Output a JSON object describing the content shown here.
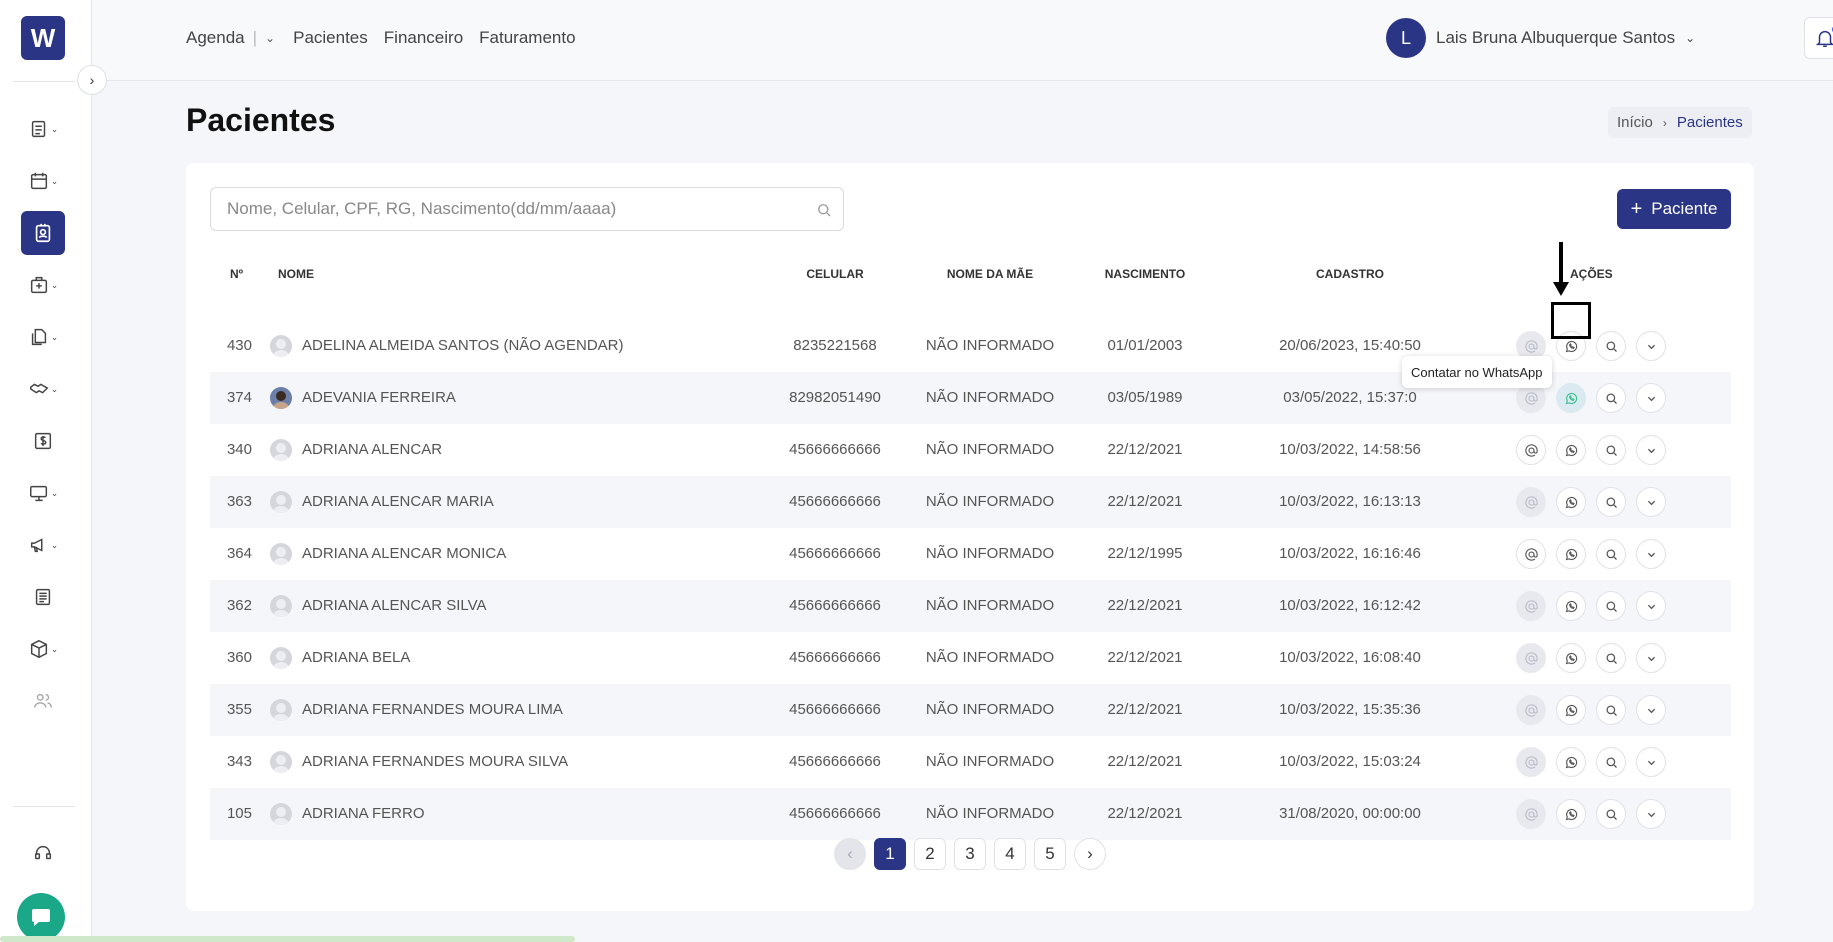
{
  "app": {
    "logo_letter": "W"
  },
  "nav": {
    "items": [
      "Agenda",
      "Pacientes",
      "Financeiro",
      "Faturamento"
    ]
  },
  "user": {
    "initial": "L",
    "name": "Lais Bruna Albuquerque Santos"
  },
  "page": {
    "title": "Pacientes"
  },
  "breadcrumb": {
    "home": "Início",
    "current": "Pacientes"
  },
  "search": {
    "placeholder": "Nome, Celular, CPF, RG, Nascimento(dd/mm/aaaa)",
    "value": ""
  },
  "add_button": {
    "label": "Paciente"
  },
  "table": {
    "headers": {
      "num": "Nº",
      "name": "NOME",
      "phone": "CELULAR",
      "mae": "NOME DA MÃE",
      "birth": "NASCIMENTO",
      "cad": "CADASTRO",
      "actions": "AÇÕES"
    },
    "rows": [
      {
        "num": "430",
        "name": "ADELINA ALMEIDA SANTOS (NÃO AGENDAR)",
        "phone": "8235221568",
        "mae": "NÃO INFORMADO",
        "birth": "01/01/2003",
        "cad": "20/06/2023, 15:40:50",
        "email_enabled": false,
        "photo": false
      },
      {
        "num": "374",
        "name": "ADEVANIA FERREIRA",
        "phone": "82982051490",
        "mae": "NÃO INFORMADO",
        "birth": "03/05/1989",
        "cad": "03/05/2022, 15:37:0",
        "email_enabled": false,
        "photo": true
      },
      {
        "num": "340",
        "name": "ADRIANA ALENCAR",
        "phone": "45666666666",
        "mae": "NÃO INFORMADO",
        "birth": "22/12/2021",
        "cad": "10/03/2022, 14:58:56",
        "email_enabled": true,
        "photo": false
      },
      {
        "num": "363",
        "name": "ADRIANA ALENCAR MARIA",
        "phone": "45666666666",
        "mae": "NÃO INFORMADO",
        "birth": "22/12/2021",
        "cad": "10/03/2022, 16:13:13",
        "email_enabled": false,
        "photo": false
      },
      {
        "num": "364",
        "name": "ADRIANA ALENCAR MONICA",
        "phone": "45666666666",
        "mae": "NÃO INFORMADO",
        "birth": "22/12/1995",
        "cad": "10/03/2022, 16:16:46",
        "email_enabled": true,
        "photo": false
      },
      {
        "num": "362",
        "name": "ADRIANA ALENCAR SILVA",
        "phone": "45666666666",
        "mae": "NÃO INFORMADO",
        "birth": "22/12/2021",
        "cad": "10/03/2022, 16:12:42",
        "email_enabled": false,
        "photo": false
      },
      {
        "num": "360",
        "name": "ADRIANA BELA",
        "phone": "45666666666",
        "mae": "NÃO INFORMADO",
        "birth": "22/12/2021",
        "cad": "10/03/2022, 16:08:40",
        "email_enabled": false,
        "photo": false
      },
      {
        "num": "355",
        "name": "ADRIANA FERNANDES MOURA LIMA",
        "phone": "45666666666",
        "mae": "NÃO INFORMADO",
        "birth": "22/12/2021",
        "cad": "10/03/2022, 15:35:36",
        "email_enabled": false,
        "photo": false
      },
      {
        "num": "343",
        "name": "ADRIANA FERNANDES MOURA SILVA",
        "phone": "45666666666",
        "mae": "NÃO INFORMADO",
        "birth": "22/12/2021",
        "cad": "10/03/2022, 15:03:24",
        "email_enabled": false,
        "photo": false
      },
      {
        "num": "105",
        "name": "ADRIANA FERRO",
        "phone": "45666666666",
        "mae": "NÃO INFORMADO",
        "birth": "22/12/2021",
        "cad": "31/08/2020, 00:00:00",
        "email_enabled": false,
        "photo": false
      }
    ]
  },
  "tooltip": {
    "text": "Contatar no WhatsApp"
  },
  "pagination": {
    "pages": [
      "1",
      "2",
      "3",
      "4",
      "5"
    ],
    "current": "1"
  },
  "colors": {
    "primary": "#2b3585",
    "chat": "#1ba888",
    "notification": "#3360ff"
  }
}
